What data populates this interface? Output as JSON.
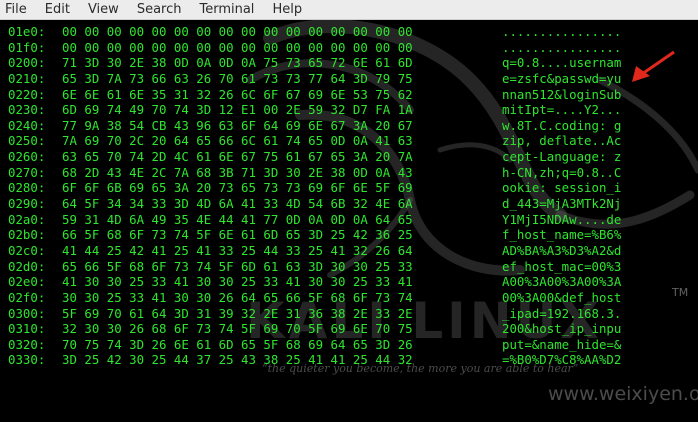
{
  "menu": {
    "items": [
      "File",
      "Edit",
      "View",
      "Search",
      "Terminal",
      "Help"
    ]
  },
  "dump": [
    {
      "offset": "01e0:",
      "hex": "00 00 00 00 00 00 00 00 00 00 00 00 00 00 00 00",
      "ascii": "................"
    },
    {
      "offset": "01f0:",
      "hex": "00 00 00 00 00 00 00 00 00 00 00 00 00 00 00 00",
      "ascii": "................"
    },
    {
      "offset": "0200:",
      "hex": "71 3D 30 2E 38 0D 0A 0D 0A 75 73 65 72 6E 61 6D",
      "ascii": "q=0.8....usernam"
    },
    {
      "offset": "0210:",
      "hex": "65 3D 7A 73 66 63 26 70 61 73 73 77 64 3D 79 75",
      "ascii": "e=zsfc&passwd=yu"
    },
    {
      "offset": "0220:",
      "hex": "6E 6E 61 6E 35 31 32 26 6C 6F 67 69 6E 53 75 62",
      "ascii": "nnan512&loginSub"
    },
    {
      "offset": "0230:",
      "hex": "6D 69 74 49 70 74 3D 12 E1 00 2E 59 32 D7 FA 1A",
      "ascii": "mitIpt=....Y2..."
    },
    {
      "offset": "0240:",
      "hex": "77 9A 38 54 CB 43 96 63 6F 64 69 6E 67 3A 20 67",
      "ascii": "w.8T.C.coding: g"
    },
    {
      "offset": "0250:",
      "hex": "7A 69 70 2C 20 64 65 66 6C 61 74 65 0D 0A 41 63",
      "ascii": "zip, deflate..Ac"
    },
    {
      "offset": "0260:",
      "hex": "63 65 70 74 2D 4C 61 6E 67 75 61 67 65 3A 20 7A",
      "ascii": "cept-Language: z"
    },
    {
      "offset": "0270:",
      "hex": "68 2D 43 4E 2C 7A 68 3B 71 3D 30 2E 38 0D 0A 43",
      "ascii": "h-CN,zh;q=0.8..C"
    },
    {
      "offset": "0280:",
      "hex": "6F 6F 6B 69 65 3A 20 73 65 73 73 69 6F 6E 5F 69",
      "ascii": "ookie: session_i"
    },
    {
      "offset": "0290:",
      "hex": "64 5F 34 34 33 3D 4D 6A 41 33 4D 54 6B 32 4E 6A",
      "ascii": "d_443=MjA3MTk2Nj"
    },
    {
      "offset": "02a0:",
      "hex": "59 31 4D 6A 49 35 4E 44 41 77 0D 0A 0D 0A 64 65",
      "ascii": "Y1MjI5NDAw....de"
    },
    {
      "offset": "02b0:",
      "hex": "66 5F 68 6F 73 74 5F 6E 61 6D 65 3D 25 42 36 25",
      "ascii": "f_host_name=%B6%"
    },
    {
      "offset": "02c0:",
      "hex": "41 44 25 42 41 25 41 33 25 44 33 25 41 32 26 64",
      "ascii": "AD%BA%A3%D3%A2&d"
    },
    {
      "offset": "02d0:",
      "hex": "65 66 5F 68 6F 73 74 5F 6D 61 63 3D 30 30 25 33",
      "ascii": "ef_host_mac=00%3"
    },
    {
      "offset": "02e0:",
      "hex": "41 30 30 25 33 41 30 30 25 33 41 30 30 25 33 41",
      "ascii": "A00%3A00%3A00%3A"
    },
    {
      "offset": "02f0:",
      "hex": "30 30 25 33 41 30 30 26 64 65 66 5F 68 6F 73 74",
      "ascii": "00%3A00&def_host"
    },
    {
      "offset": "0300:",
      "hex": "5F 69 70 61 64 3D 31 39 32 2E 31 36 38 2E 33 2E",
      "ascii": "_ipad=192.168.3."
    },
    {
      "offset": "0310:",
      "hex": "32 30 30 26 68 6F 73 74 5F 69 70 5F 69 6E 70 75",
      "ascii": "200&host_ip_inpu"
    },
    {
      "offset": "0320:",
      "hex": "70 75 74 3D 26 6E 61 6D 65 5F 68 69 64 65 3D 26",
      "ascii": "put=&name_hide=&"
    },
    {
      "offset": "0330:",
      "hex": "3D 25 42 30 25 44 37 25 43 38 25 41 41 25 44 32",
      "ascii": "=%B0%D7%C8%AA%D2"
    }
  ],
  "watermark": {
    "brand": "KALI LINUX",
    "trademark": "TM",
    "tagline": "“the quieter you become, the more you are able to hear”",
    "site": "www.weixiyen.org"
  },
  "colors": {
    "text": "#2fe52f",
    "background": "#000000",
    "arrow": "#e0281c"
  }
}
